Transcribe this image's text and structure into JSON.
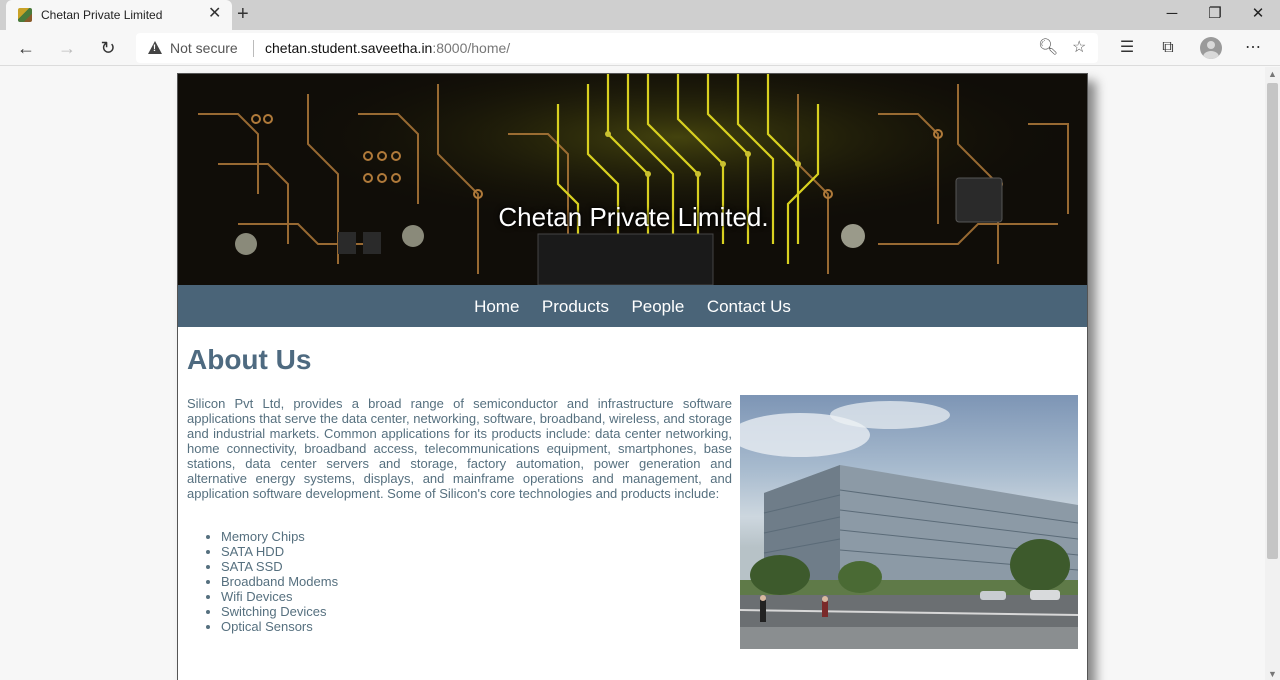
{
  "browser": {
    "tab_title": "Chetan Private Limited",
    "not_secure": "Not secure",
    "url_host": "chetan.student.saveetha.in",
    "url_rest": ":8000/home/"
  },
  "page": {
    "banner_title": "Chetan Private Limited.",
    "nav": [
      "Home",
      "Products",
      "People",
      "Contact Us"
    ],
    "about": {
      "heading": "About Us",
      "paragraph": "Silicon Pvt Ltd, provides a broad range of semiconductor and infrastructure software applications that serve the data center, networking, software, broadband, wireless, and storage and industrial markets. Common applications for its products include: data center networking, home connectivity, broadband access, telecommunications equipment, smartphones, base stations, data center servers and storage, factory automation, power generation and alternative energy systems, displays, and mainframe operations and management, and application software development. Some of Silicon's core technologies and products include:",
      "products": [
        "Memory Chips",
        "SATA HDD",
        "SATA SSD",
        "Broadband Modems",
        "Wifi Devices",
        "Switching Devices",
        "Optical Sensors"
      ]
    }
  }
}
